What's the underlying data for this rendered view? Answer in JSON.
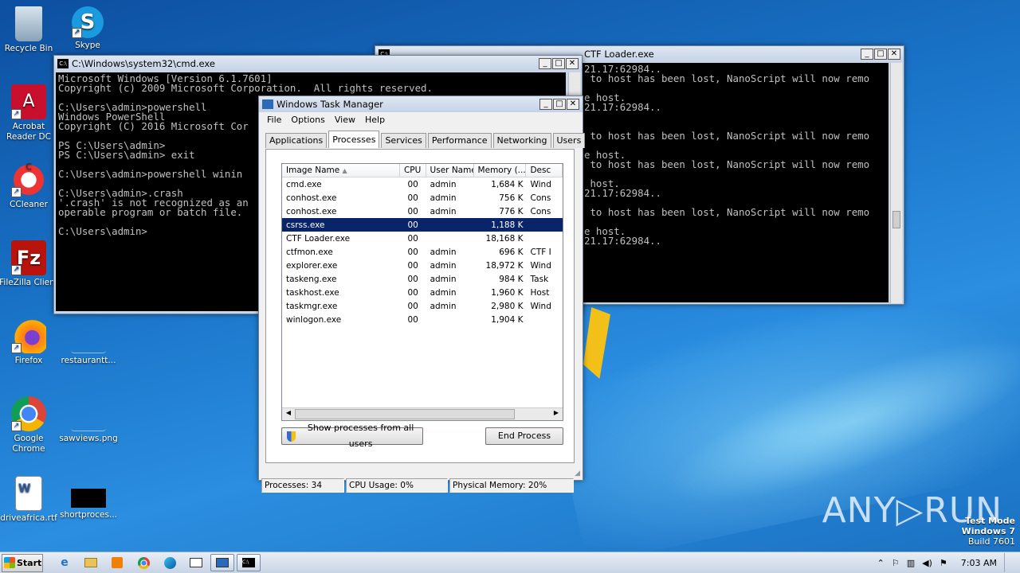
{
  "desktop": {
    "icons": [
      {
        "label": "Recycle Bin"
      },
      {
        "label": "Skype"
      },
      {
        "label": "Acrobat Reader DC"
      },
      {
        "label": "CCleaner"
      },
      {
        "label": "FileZilla Client"
      },
      {
        "label": "Firefox"
      },
      {
        "label": "restaurantt..."
      },
      {
        "label": "Google Chrome"
      },
      {
        "label": "sawviews.png"
      },
      {
        "label": "driveafrica.rtf"
      },
      {
        "label": "shortproces..."
      }
    ]
  },
  "cmd_window": {
    "title": "C:\\Windows\\system32\\cmd.exe",
    "text": "Microsoft Windows [Version 6.1.7601]\nCopyright (c) 2009 Microsoft Corporation.  All rights reserved.\n\nC:\\Users\\admin>powershell\nWindows PowerShell\nCopyright (C) 2016 Microsoft Cor\n\nPS C:\\Users\\admin>\nPS C:\\Users\\admin> exit\n\nC:\\Users\\admin>powershell winin\n\nC:\\Users\\admin>.crash\n'.crash' is not recognized as an\noperable program or batch file.\n\nC:\\Users\\admin>"
  },
  "loader_window": {
    "title": "CTF Loader.exe",
    "text": "21.17:62984..\n to host has been lost, NanoScript will now remo\n\ne host.\n21.17:62984..\n\n\n to host has been lost, NanoScript will now remo\n\ne host.\n to host has been lost, NanoScript will now remo\n\n host.\n21.17:62984..\n\n to host has been lost, NanoScript will now remo\n\ne host.\n21.17:62984.."
  },
  "taskmgr": {
    "title": "Windows Task Manager",
    "menu": [
      "File",
      "Options",
      "View",
      "Help"
    ],
    "tabs": [
      "Applications",
      "Processes",
      "Services",
      "Performance",
      "Networking",
      "Users"
    ],
    "columns": [
      "Image Name",
      "CPU",
      "User Name",
      "Memory (...",
      "Desc"
    ],
    "rows": [
      {
        "name": "cmd.exe",
        "cpu": "00",
        "user": "admin",
        "mem": "1,684 K",
        "desc": "Wind"
      },
      {
        "name": "conhost.exe",
        "cpu": "00",
        "user": "admin",
        "mem": "756 K",
        "desc": "Cons"
      },
      {
        "name": "conhost.exe",
        "cpu": "00",
        "user": "admin",
        "mem": "776 K",
        "desc": "Cons"
      },
      {
        "name": "csrss.exe",
        "cpu": "00",
        "user": "",
        "mem": "1,188 K",
        "desc": ""
      },
      {
        "name": "CTF Loader.exe",
        "cpu": "00",
        "user": "",
        "mem": "18,168 K",
        "desc": ""
      },
      {
        "name": "ctfmon.exe",
        "cpu": "00",
        "user": "admin",
        "mem": "696 K",
        "desc": "CTF I"
      },
      {
        "name": "explorer.exe",
        "cpu": "00",
        "user": "admin",
        "mem": "18,972 K",
        "desc": "Wind"
      },
      {
        "name": "taskeng.exe",
        "cpu": "00",
        "user": "admin",
        "mem": "984 K",
        "desc": "Task"
      },
      {
        "name": "taskhost.exe",
        "cpu": "00",
        "user": "admin",
        "mem": "1,960 K",
        "desc": "Host"
      },
      {
        "name": "taskmgr.exe",
        "cpu": "00",
        "user": "admin",
        "mem": "2,980 K",
        "desc": "Wind"
      },
      {
        "name": "winlogon.exe",
        "cpu": "00",
        "user": "",
        "mem": "1,904 K",
        "desc": ""
      }
    ],
    "show_all_label": "Show processes from all users",
    "end_process_label": "End Process",
    "status": {
      "processes": "Processes: 34",
      "cpu": "CPU Usage: 0%",
      "memory": "Physical Memory: 20%"
    }
  },
  "taskbar": {
    "start_label": "Start",
    "clock": "7:03 AM"
  },
  "watermark": "ANY▷RUN",
  "test_mode": [
    "Test Mode",
    "Windows 7",
    "Build 7601"
  ]
}
